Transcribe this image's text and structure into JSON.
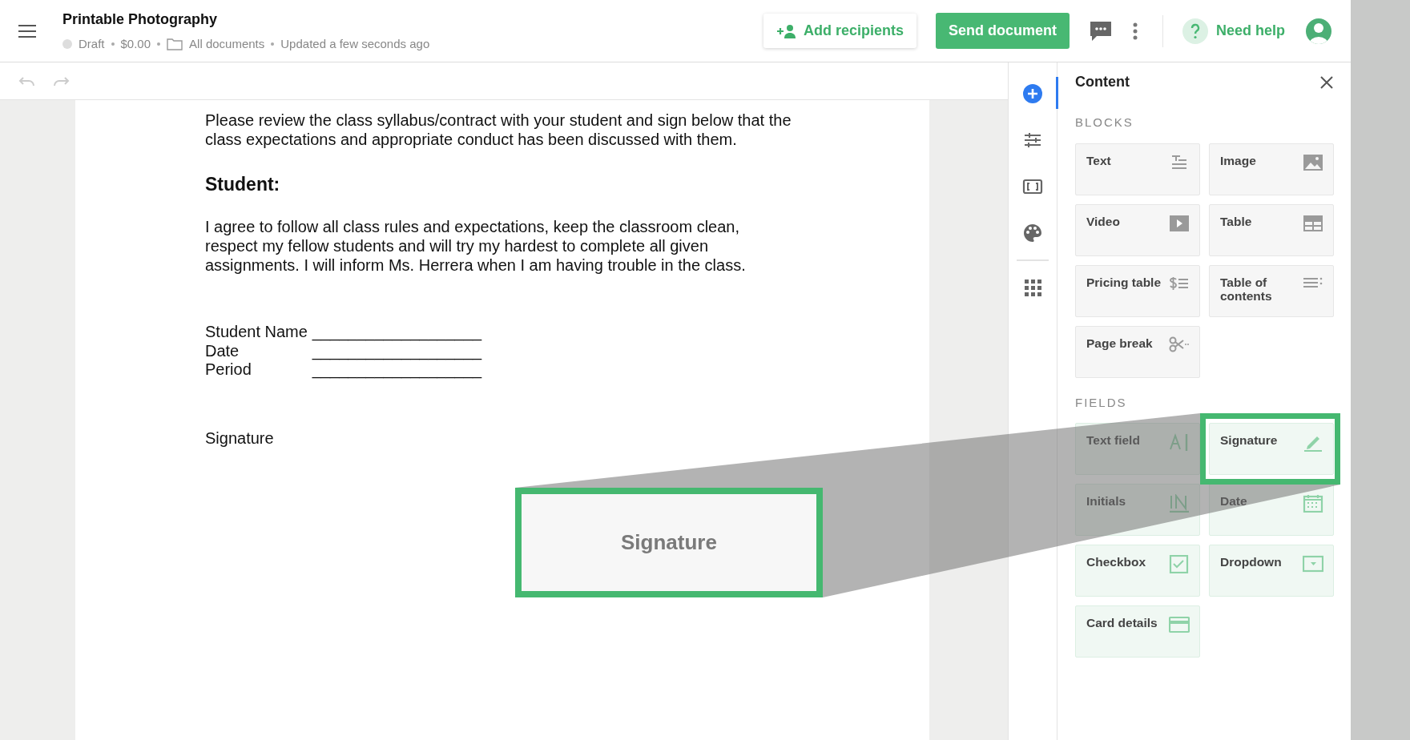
{
  "header": {
    "title": "Printable Photography",
    "status": "Draft",
    "price": "$0.00",
    "folder": "All documents",
    "updated": "Updated a few seconds ago"
  },
  "actions": {
    "add_recipients": "Add recipients",
    "send": "Send document",
    "help": "Need help"
  },
  "document": {
    "intro": "Please review the class syllabus/contract with your student and sign below that the class expectations and appropriate conduct has been discussed with them.",
    "heading": "Student:",
    "agreement": "I agree to follow all class rules and expectations, keep the classroom clean, respect my fellow students and will try my hardest to complete all given assignments. I will inform Ms. Herrera when I am having trouble in the class.",
    "form_lines": [
      {
        "label": "Student Name",
        "line": "___________________"
      },
      {
        "label": "Date",
        "line": "___________________"
      },
      {
        "label": "Period",
        "line": "___________________"
      }
    ],
    "signature_label": "Signature"
  },
  "rail_tabs": [
    {
      "selected": true
    },
    {
      "selected": false
    },
    {
      "selected": false
    },
    {
      "selected": false
    },
    {
      "selected": false
    }
  ],
  "panel": {
    "title": "Content",
    "sections": [
      {
        "heading": "BLOCKS",
        "kind": "block",
        "items": [
          {
            "label": "Text",
            "selected": false
          },
          {
            "label": "Image",
            "selected": false
          },
          {
            "label": "Video",
            "selected": false
          },
          {
            "label": "Table",
            "selected": false
          },
          {
            "label": "Pricing table",
            "selected": false
          },
          {
            "label": "Table of contents",
            "selected": false
          },
          {
            "label": "Page break",
            "selected": false
          }
        ]
      },
      {
        "heading": "FIELDS",
        "kind": "field",
        "items": [
          {
            "label": "Text field",
            "selected": false
          },
          {
            "label": "Signature",
            "selected": true
          },
          {
            "label": "Initials",
            "selected": false
          },
          {
            "label": "Date",
            "selected": false
          },
          {
            "label": "Checkbox",
            "selected": false
          },
          {
            "label": "Dropdown",
            "selected": false
          },
          {
            "label": "Card details",
            "selected": false
          }
        ]
      }
    ]
  },
  "callout": {
    "label": "Signature"
  }
}
